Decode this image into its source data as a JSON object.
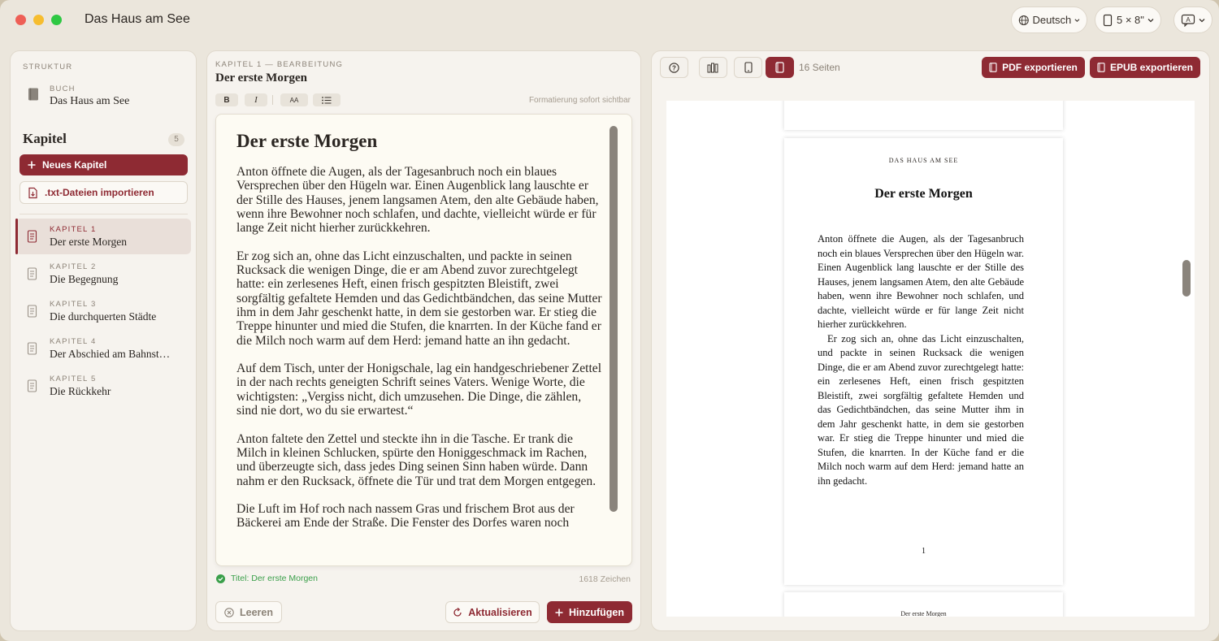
{
  "window": {
    "title": "Das Haus am See"
  },
  "toolbar": {
    "language": "Deutsch",
    "page_size": "5 × 8\""
  },
  "sidebar": {
    "section_label": "STRUKTUR",
    "book_label": "BUCH",
    "book_title": "Das Haus am See",
    "chapters_heading": "Kapitel",
    "chapters_count": "5",
    "new_chapter_label": "Neues Kapitel",
    "import_label": ".txt-Dateien importieren",
    "chapters": [
      {
        "number": "KAPITEL 1",
        "title": "Der erste Morgen",
        "active": true
      },
      {
        "number": "KAPITEL 2",
        "title": "Die Begegnung",
        "active": false
      },
      {
        "number": "KAPITEL 3",
        "title": "Die durchquerten Städte",
        "active": false
      },
      {
        "number": "KAPITEL 4",
        "title": "Der Abschied am Bahnst…",
        "active": false
      },
      {
        "number": "KAPITEL 5",
        "title": "Die Rückkehr",
        "active": false
      }
    ]
  },
  "editor": {
    "breadcrumb": "KAPITEL 1 — BEARBEITUNG",
    "title": "Der erste Morgen",
    "format": {
      "bold": "B",
      "italic": "I",
      "size": "AA",
      "hint": "Formatierung sofort sichtbar"
    },
    "heading": "Der erste Morgen",
    "paragraphs": [
      "Anton öffnete die Augen, als der Tagesanbruch noch ein blaues Versprechen über den Hügeln war. Einen Augenblick lang lauschte er der Stille des Hauses, jenem langsamen Atem, den alte Gebäude haben, wenn ihre Bewohner noch schlafen, und dachte, vielleicht würde er für lange Zeit nicht hierher zurückkehren.",
      "Er zog sich an, ohne das Licht einzuschalten, und packte in seinen Rucksack die wenigen Dinge, die er am Abend zuvor zurechtgelegt hatte: ein zerlesenes Heft, einen frisch gespitzten Bleistift, zwei sorgfältig gefaltete Hemden und das Gedichtbändchen, das seine Mutter ihm in dem Jahr geschenkt hatte, in dem sie gestorben war. Er stieg die Treppe hinunter und mied die Stufen, die knarrten. In der Küche fand er die Milch noch warm auf dem Herd: jemand hatte an ihn gedacht.",
      "Auf dem Tisch, unter der Honigschale, lag ein handgeschriebener Zettel in der nach rechts geneigten Schrift seines Vaters. Wenige Worte, die wichtigsten: „Vergiss nicht, dich umzusehen. Die Dinge, die zählen, sind nie dort, wo du sie erwartest.“",
      "Anton faltete den Zettel und steckte ihn in die Tasche. Er trank die Milch in kleinen Schlucken, spürte den Honiggeschmack im Rachen, und überzeugte sich, dass jedes Ding seinen Sinn haben würde. Dann nahm er den Rucksack, öffnete die Tür und trat dem Morgen entgegen.",
      "Die Luft im Hof roch nach nassem Gras und frischem Brot aus der Bäckerei am Ende der Straße. Die Fenster des Dorfes waren noch"
    ],
    "status": "Titel: Der erste Morgen",
    "char_count": "1618 Zeichen",
    "clear_label": "Leeren",
    "update_label": "Aktualisieren",
    "add_label": "Hinzufügen"
  },
  "preview": {
    "pages_label": "16 Seiten",
    "pdf_label": "PDF exportieren",
    "epub_label": "EPUB exportieren",
    "running_head": "DAS HAUS AM SEE",
    "page_heading": "Der erste Morgen",
    "page_paragraphs": [
      "Anton öffnete die Augen, als der Tagesanbruch noch ein blaues Versprechen über den Hügeln war. Einen Augenblick lang lauschte er der Stille des Hauses, jenem langsamen Atem, den alte Gebäude haben, wenn ihre Bewohner noch schlafen, und dachte, vielleicht würde er für lange Zeit nicht hierher zurückkehren.",
      "Er zog sich an, ohne das Licht einzuschalten, und packte in seinen Rucksack die wenigen Dinge, die er am Abend zuvor zurechtgelegt hatte: ein zerlesenes Heft, einen frisch gespitzten Bleistift, zwei sorgfältig gefaltete Hemden und das Gedichtbändchen, das seine Mutter ihm in dem Jahr geschenkt hatte, in dem sie gestorben war. Er stieg die Treppe hinunter und mied die Stufen, die knarrten. In der Küche fand er die Milch noch warm auf dem Herd: jemand hatte an ihn gedacht."
    ],
    "page_number": "1",
    "next_page_head": "Der erste Morgen"
  },
  "colors": {
    "accent": "#8e2a33",
    "success": "#3a9f4a",
    "background": "#ebe6dc"
  }
}
